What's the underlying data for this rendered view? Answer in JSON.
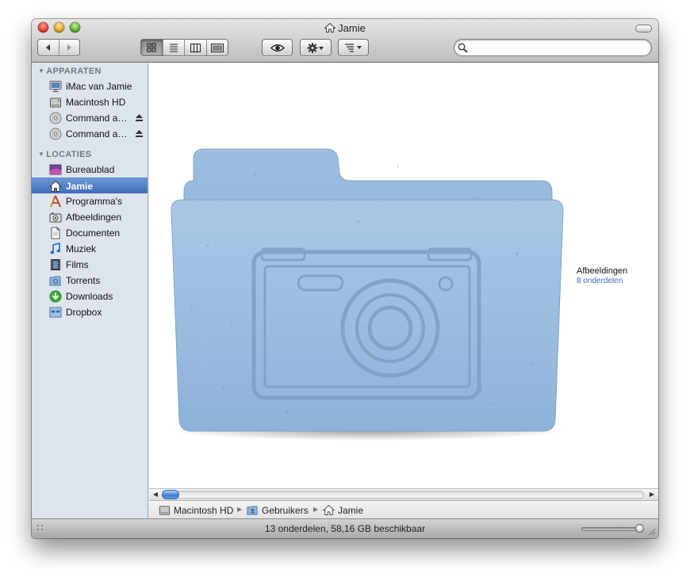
{
  "window": {
    "title": "Jamie"
  },
  "toolbar": {
    "back_icon": "back-arrow-icon",
    "forward_icon": "forward-arrow-icon",
    "view_modes": [
      "icon-view",
      "list-view",
      "column-view",
      "coverflow-view"
    ],
    "active_view": "icon-view",
    "quicklook_icon": "eye-icon",
    "action_icon": "gear-icon",
    "arrange_icon": "arrange-icon"
  },
  "search": {
    "value": "",
    "placeholder": ""
  },
  "sidebar": {
    "devices_header": "APPARATEN",
    "devices": [
      {
        "label": "iMac van Jamie",
        "icon": "imac-icon"
      },
      {
        "label": "Macintosh HD",
        "icon": "hard-drive-icon"
      },
      {
        "label": "Command a…",
        "icon": "disc-icon",
        "eject": true
      },
      {
        "label": "Command a…",
        "icon": "disc-icon",
        "eject": true
      }
    ],
    "places_header": "LOCATIES",
    "places": [
      {
        "label": "Bureaublad",
        "icon": "desktop-icon"
      },
      {
        "label": "Jamie",
        "icon": "home-icon",
        "selected": true
      },
      {
        "label": "Programma's",
        "icon": "applications-icon"
      },
      {
        "label": "Afbeeldingen",
        "icon": "pictures-icon"
      },
      {
        "label": "Documenten",
        "icon": "documents-icon"
      },
      {
        "label": "Muziek",
        "icon": "music-icon"
      },
      {
        "label": "Films",
        "icon": "movies-icon"
      },
      {
        "label": "Torrents",
        "icon": "folder-icon"
      },
      {
        "label": "Downloads",
        "icon": "downloads-icon"
      },
      {
        "label": "Dropbox",
        "icon": "dropbox-icon"
      }
    ]
  },
  "content": {
    "folder_name": "Afbeeldingen",
    "folder_count": "8 onderdelen",
    "folder_color": "#8fb3d8"
  },
  "pathbar": {
    "items": [
      {
        "label": "Macintosh HD",
        "icon": "hard-drive-icon"
      },
      {
        "label": "Gebruikers",
        "icon": "users-folder-icon"
      },
      {
        "label": "Jamie",
        "icon": "home-icon"
      }
    ]
  },
  "status": {
    "text": "13 onderdelen, 58,16 GB beschikbaar"
  },
  "colors": {
    "selection": "#3d6cb8",
    "sidebar_bg": "#dde4ec"
  }
}
